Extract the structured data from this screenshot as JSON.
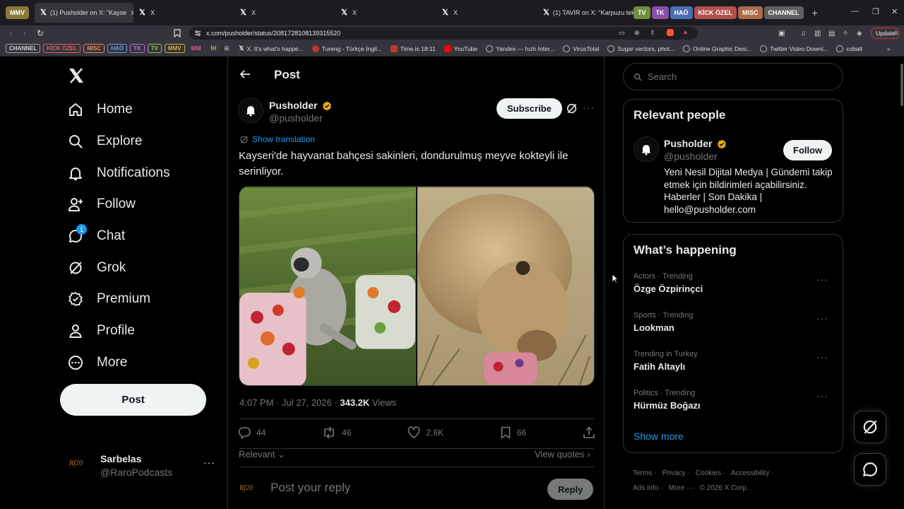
{
  "browser": {
    "tabs": [
      {
        "label": "MMV",
        "kind": "group",
        "color": "#8a7a3a"
      },
      {
        "label": "(1) Pusholder on X: \"Kayse",
        "active": true
      },
      {
        "label": "X"
      },
      {
        "label": "X"
      },
      {
        "label": "X"
      },
      {
        "label": "X"
      },
      {
        "label": "(1) TAVIR on X: \"Karpuzu tek ha"
      }
    ],
    "tab_groups": [
      {
        "label": "TV",
        "color": "#6f8f3a"
      },
      {
        "label": "TK",
        "color": "#8a4fa8"
      },
      {
        "label": "HAÖ",
        "color": "#4a6fb0"
      },
      {
        "label": "KİCK ÖZEL",
        "color": "#b0504a"
      },
      {
        "label": "MISC",
        "color": "#b06a4a"
      },
      {
        "label": "CHANNEL",
        "color": "#606060"
      }
    ],
    "url": "x.com/pusholder/status/2081728108139315520",
    "update_label": "Update",
    "bookmark_groups": [
      {
        "label": "CHANNEL",
        "color": "#9aa0a6"
      },
      {
        "label": "KİCK ÖZEL",
        "color": "#e06060"
      },
      {
        "label": "MISC",
        "color": "#e08a60"
      },
      {
        "label": "HAÖ",
        "color": "#6a9ae0"
      },
      {
        "label": "TK",
        "color": "#b070e0"
      },
      {
        "label": "TV",
        "color": "#90c050"
      },
      {
        "label": "MMV",
        "color": "#d0b040"
      },
      {
        "label": "BNİ",
        "color": "#e06090"
      },
      {
        "label": "İH",
        "color": "#d0b040"
      }
    ],
    "bookmarks": [
      {
        "label": "X. It's what's happe...",
        "icon": "x-icon"
      },
      {
        "label": "Tureng - Türkçe İngil...",
        "icon": "tureng-icon"
      },
      {
        "label": "Time.is 18:11",
        "icon": "timeis-icon"
      },
      {
        "label": "YouTube",
        "icon": "youtube-icon"
      },
      {
        "label": "Yandex — hızlı İnter...",
        "icon": "globe-icon"
      },
      {
        "label": "VirusTotal",
        "icon": "globe-icon"
      },
      {
        "label": "Sugar vectors, phot...",
        "icon": "globe-icon"
      },
      {
        "label": "Online Graphic Desi...",
        "icon": "globe-icon"
      },
      {
        "label": "Twitter Video Downl...",
        "icon": "globe-icon"
      },
      {
        "label": "cobalt",
        "icon": "globe-icon"
      }
    ]
  },
  "sidebar": {
    "items": [
      {
        "label": "Home",
        "icon": "home-icon"
      },
      {
        "label": "Explore",
        "icon": "search-icon"
      },
      {
        "label": "Notifications",
        "icon": "bell-icon"
      },
      {
        "label": "Follow",
        "icon": "person-plus-icon"
      },
      {
        "label": "Chat",
        "icon": "chat-icon",
        "badge": "1"
      },
      {
        "label": "Grok",
        "icon": "grok-icon"
      },
      {
        "label": "Premium",
        "icon": "premium-icon"
      },
      {
        "label": "Profile",
        "icon": "person-icon"
      },
      {
        "label": "More",
        "icon": "more-circle-icon"
      }
    ],
    "post_label": "Post",
    "account": {
      "name": "Sarbelas",
      "handle": "@RaroPodcasts",
      "avatar_text": "Rf20"
    }
  },
  "main": {
    "header_title": "Post",
    "author": {
      "name": "Pusholder",
      "handle": "@pusholder"
    },
    "subscribe_label": "Subscribe",
    "show_translation": "Show translation",
    "tweet_text": "Kayseri'de hayvanat bahçesi sakinleri, dondurulmuş meyve kokteyli ile serinliyor.",
    "timestamp": "4:07 PM · Jul 27, 2026 · ",
    "views_count": "343.2K",
    "views_label": " Views",
    "stats": {
      "replies": "44",
      "reposts": "46",
      "likes": "2.6K",
      "bookmarks": "66"
    },
    "relevant_label": "Relevant",
    "view_quotes_label": "View quotes",
    "reply_placeholder": "Post your reply",
    "reply_button": "Reply"
  },
  "right": {
    "search_placeholder": "Search",
    "relevant_people_title": "Relevant people",
    "person": {
      "name": "Pusholder",
      "handle": "@pusholder",
      "follow_label": "Follow",
      "bio": "Yeni Nesil Dijital Medya | Gündemi takip etmek için bildirimleri açabilirsiniz. Haberler | Son Dakika | hello@pusholder.com"
    },
    "whats_happening_title": "What’s happening",
    "trends": [
      {
        "meta": "Actors · Trending",
        "name": "Özge Özpirinçci"
      },
      {
        "meta": "Sports · Trending",
        "name": "Lookman"
      },
      {
        "meta": "Trending in Turkey",
        "name": "Fatih Altaylı"
      },
      {
        "meta": "Politics · Trending",
        "name": "Hürmüz Boğazı"
      }
    ],
    "show_more": "Show more",
    "footer": {
      "terms": "Terms",
      "privacy": "Privacy",
      "cookies": "Cookies",
      "accessibility": "Accessibility",
      "ads_info": "Ads info",
      "more": "More ···",
      "copyright": "© 2026 X Corp."
    }
  },
  "colors": {
    "accent": "#1d9bf0",
    "verified": "#e8b00d",
    "text_secondary": "#71767b"
  }
}
